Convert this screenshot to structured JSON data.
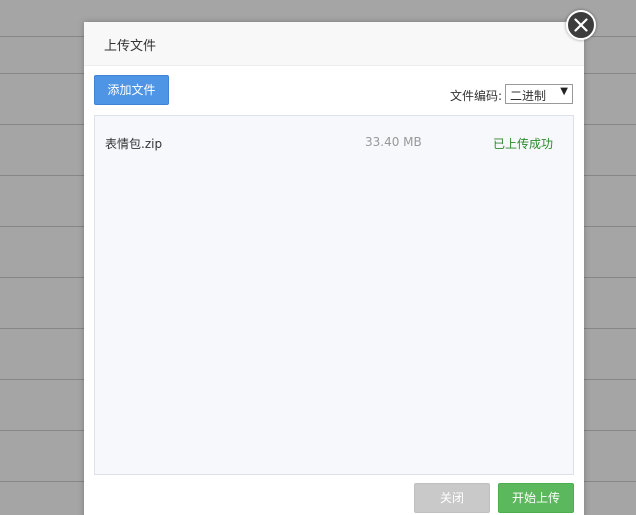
{
  "dialog": {
    "title": "上传文件",
    "add_file_label": "添加文件",
    "encoding_label": "文件编码:",
    "encoding_value": "二进制",
    "encoding_arrow": "▼",
    "close_label": "关闭",
    "start_upload_label": "开始上传"
  },
  "files": [
    {
      "name": "表情包.zip",
      "size": "33.40 MB",
      "status": "已上传成功"
    }
  ],
  "icons": {
    "close": "close-icon",
    "select_arrow": "chevron-down-icon"
  },
  "colors": {
    "primary": "#4e95e6",
    "success": "#5cb85c",
    "status_success": "#2c8a2c",
    "disabled": "#c9c9c9"
  }
}
